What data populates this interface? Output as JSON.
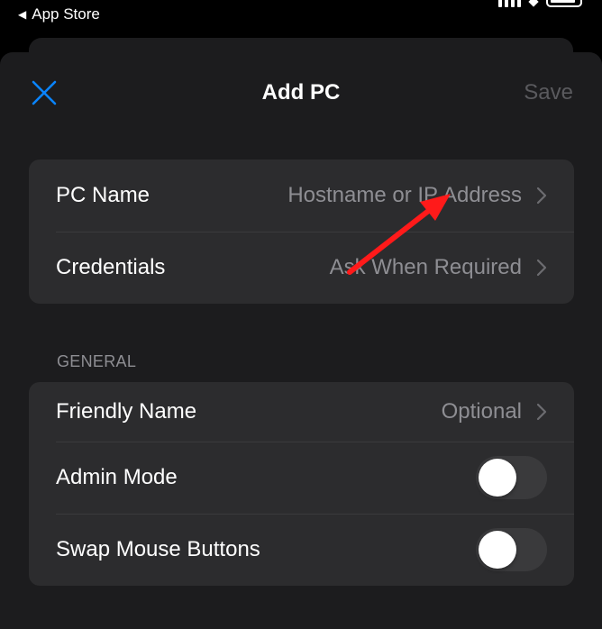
{
  "status_bar": {
    "back_label": "App Store"
  },
  "nav": {
    "title": "Add PC",
    "save_label": "Save",
    "accent_color": "#0a84ff"
  },
  "connection_group": [
    {
      "label": "PC Name",
      "value": "Hostname or IP Address"
    },
    {
      "label": "Credentials",
      "value": "Ask When Required"
    }
  ],
  "general": {
    "header": "GENERAL",
    "friendly_name": {
      "label": "Friendly Name",
      "value": "Optional"
    },
    "admin_mode": {
      "label": "Admin Mode",
      "enabled": false
    },
    "swap_mouse": {
      "label": "Swap Mouse Buttons",
      "enabled": false
    }
  },
  "annotation": {
    "color": "#ff1a1a"
  }
}
